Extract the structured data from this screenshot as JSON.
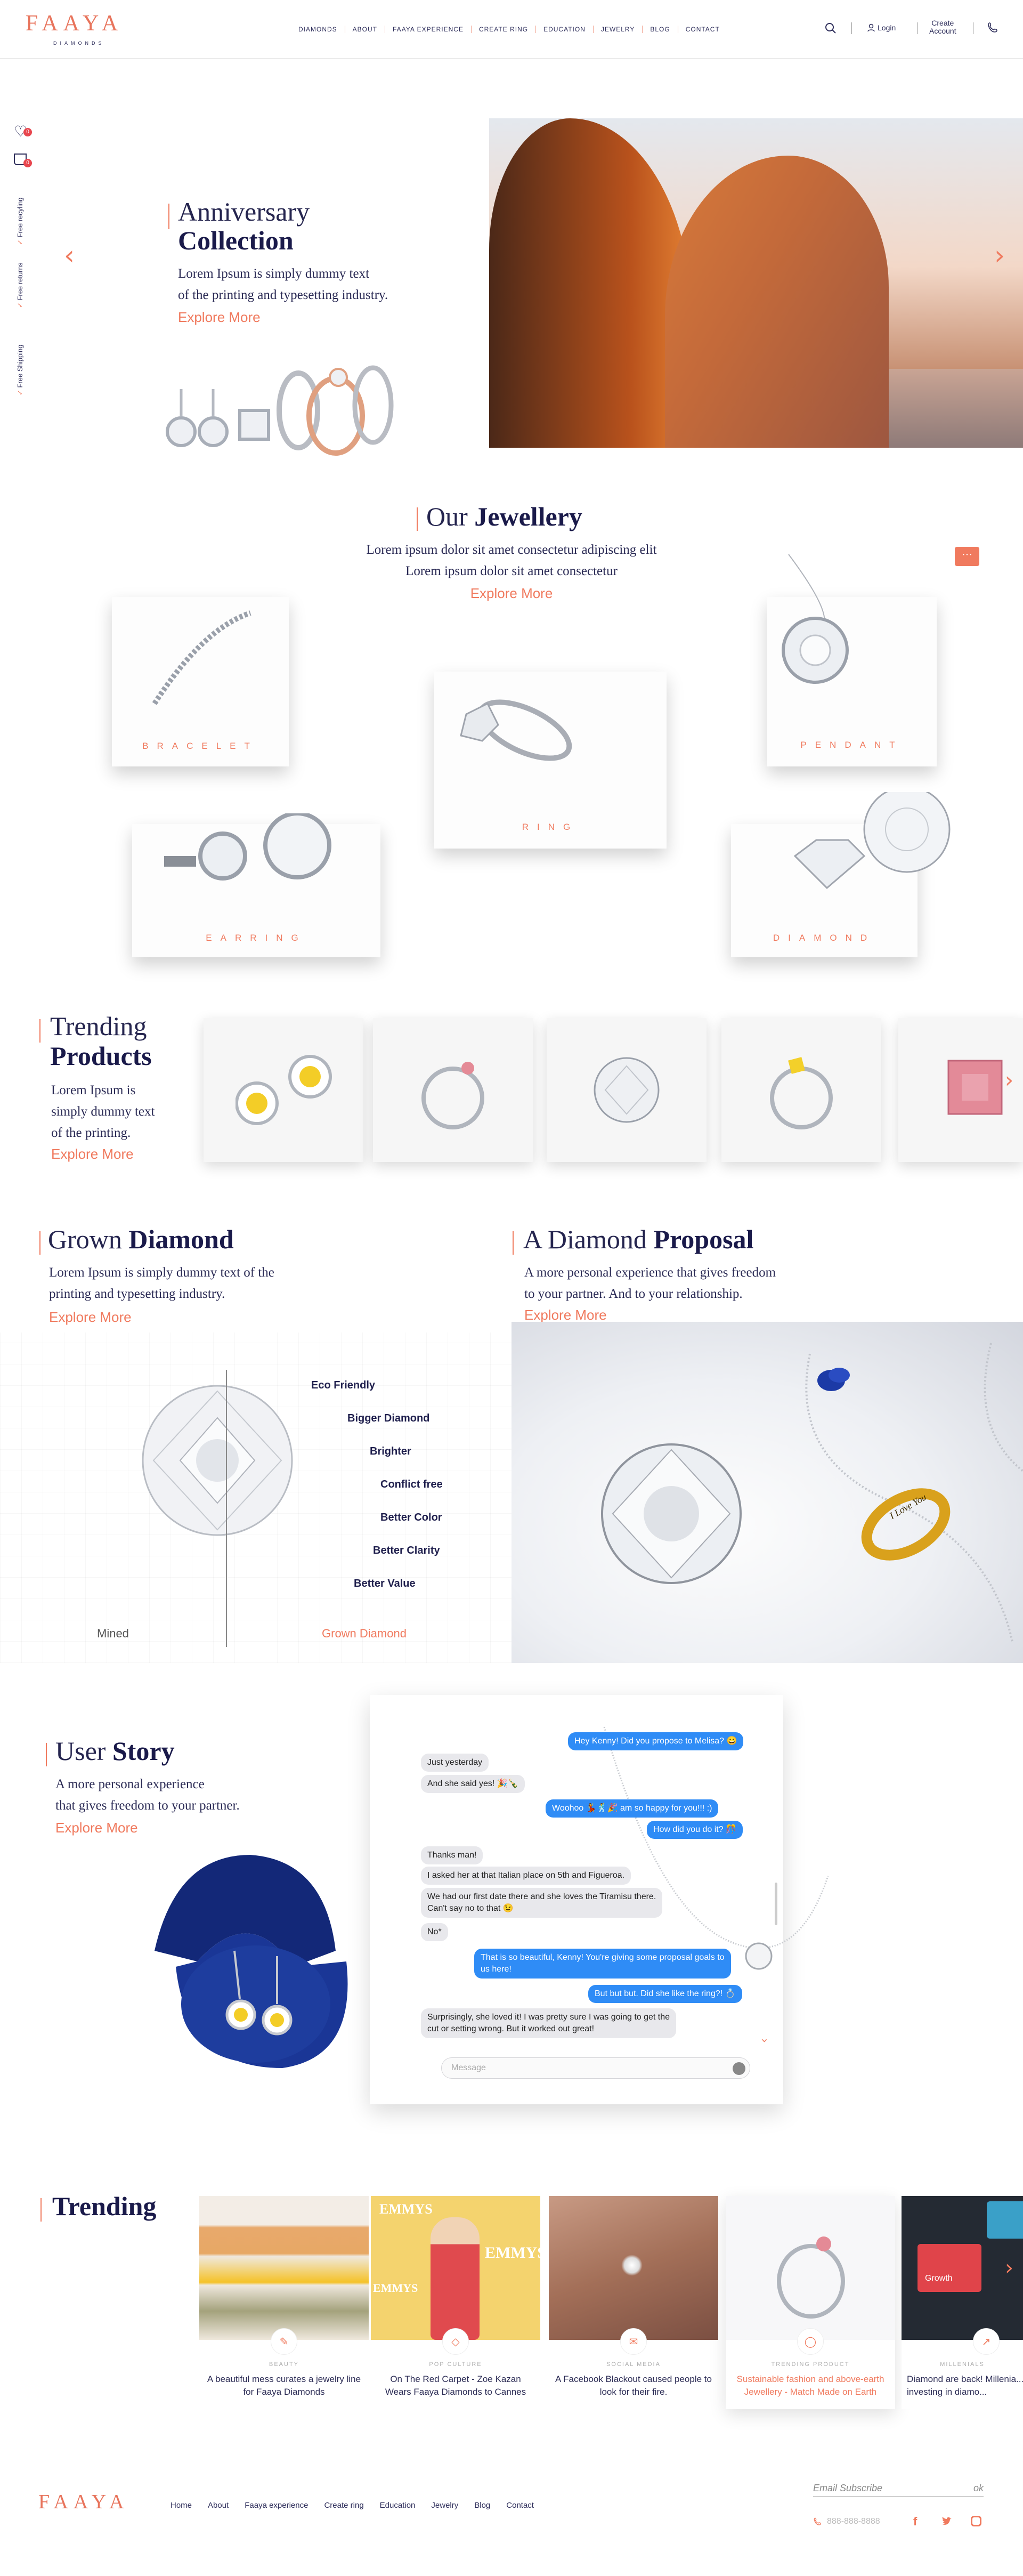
{
  "brand": {
    "logo": "FAAYA",
    "sub": "DIAMONDS"
  },
  "nav": [
    "DIAMONDS",
    "ABOUT",
    "FAAYA EXPERIENCE",
    "CREATE RING",
    "EDUCATION",
    "JEWELRY",
    "BLOG",
    "CONTACT"
  ],
  "header": {
    "login": "Login",
    "create_account_1": "Create",
    "create_account_2": "Account",
    "wishlist_count": "0",
    "cart_count": "0"
  },
  "side": {
    "recycling": "Free recyling",
    "returns": "Free returns",
    "shipping": "Free Shipping"
  },
  "hero": {
    "title_light": "Anniversary",
    "title_bold": "Collection",
    "line1": "Lorem Ipsum is simply dummy text",
    "line2": "of the printing and typesetting industry.",
    "explore": "Explore More"
  },
  "jewellery": {
    "title_light": "Our",
    "title_bold": "Jewellery",
    "line1": "Lorem ipsum dolor sit amet consectetur adipiscing elit",
    "line2": "Lorem ipsum dolor sit amet consectetur",
    "explore": "Explore More",
    "cards": [
      "BRACELET",
      "RING",
      "PENDANT",
      "EARRING",
      "DIAMOND"
    ]
  },
  "trending_products": {
    "title_light": "Trending",
    "title_bold": "Products",
    "line1": "Lorem Ipsum is",
    "line2": "simply dummy text",
    "line3": "of the printing.",
    "explore": "Explore More"
  },
  "grown": {
    "title_light": "Grown",
    "title_bold": "Diamond",
    "line1": "Lorem Ipsum is simply dummy text of the",
    "line2": "printing and typesetting industry.",
    "explore": "Explore More",
    "features": [
      "Eco Friendly",
      "Bigger Diamond",
      "Brighter",
      "Conflict free",
      "Better Color",
      "Better Clarity",
      "Better Value"
    ],
    "label_mined": "Mined",
    "label_grown": "Grown Diamond"
  },
  "proposal": {
    "title_light": "A Diamond",
    "title_bold": "Proposal",
    "line1": "A more personal experience that gives freedom",
    "line2": "to your partner.  And to your relationship.",
    "explore": "Explore More",
    "ring_engraving": "I Love You"
  },
  "story": {
    "title_light": "User",
    "title_bold": "Story",
    "line1": "A more personal experience",
    "line2": "that gives freedom to your partner.",
    "explore": "Explore More"
  },
  "chat": {
    "m1": "Hey Kenny! Did you propose to Melisa? 😀",
    "m2": "Just yesterday",
    "m3": "And she said yes! 🎉🍾",
    "m4": "Woohoo 💃🕺🎉 am so happy for you!!! :)",
    "m5": "How did you do it? 🎊",
    "m6": "Thanks man!",
    "m7": "I asked her at that Italian place on 5th and Figueroa.",
    "m8a": "We had our first date there and she loves the Tiramisu there.",
    "m8b": "Can't say no to that 😉",
    "m9": "No*",
    "m10a": "That is so beautiful, Kenny! You're giving some proposal goals to",
    "m10b": "us here!",
    "m11": "But but but. Did she like the ring?! 💍",
    "m12a": "Surprisingly, she loved it! I was pretty sure I was going to get the",
    "m12b": "cut or setting wrong. But it worked out great!",
    "placeholder": "Message"
  },
  "trending_blog": {
    "title": "Trending",
    "cards": [
      {
        "cat": "BEAUTY",
        "caption": "A beautiful mess curates a jewelry line for Faaya Diamonds"
      },
      {
        "cat": "POP CULTURE",
        "caption": "On The Red Carpet - Zoe Kazan Wears Faaya Diamonds to Cannes",
        "emmy_top": "EMMYS",
        "emmy_side": "EMMYS",
        "emmy_sign": "EMMYS"
      },
      {
        "cat": "SOCIAL MEDIA",
        "caption": "A Facebook Blackout caused people to look for their fire."
      },
      {
        "cat": "TRENDING PRODUCT",
        "caption": "Sustainable fashion and above-earth Jewellery - Match Made on Earth"
      },
      {
        "cat": "MILLENIALS",
        "caption": "Diamond are back! Millenia... begun investing in diamo...",
        "keyboard_key": "Growth"
      }
    ]
  },
  "footer": {
    "logo": "FAAYA",
    "links": [
      "Home",
      "About",
      "Faaya experience",
      "Create ring",
      "Education",
      "Jewelry",
      "Blog",
      "Contact"
    ],
    "email_placeholder": "Email Subscribe",
    "ok": "ok",
    "phone": "888-888-8888"
  },
  "colors": {
    "accent": "#f07a5e",
    "navy": "#1a1a4a",
    "chat_blue": "#2f8cf6"
  }
}
